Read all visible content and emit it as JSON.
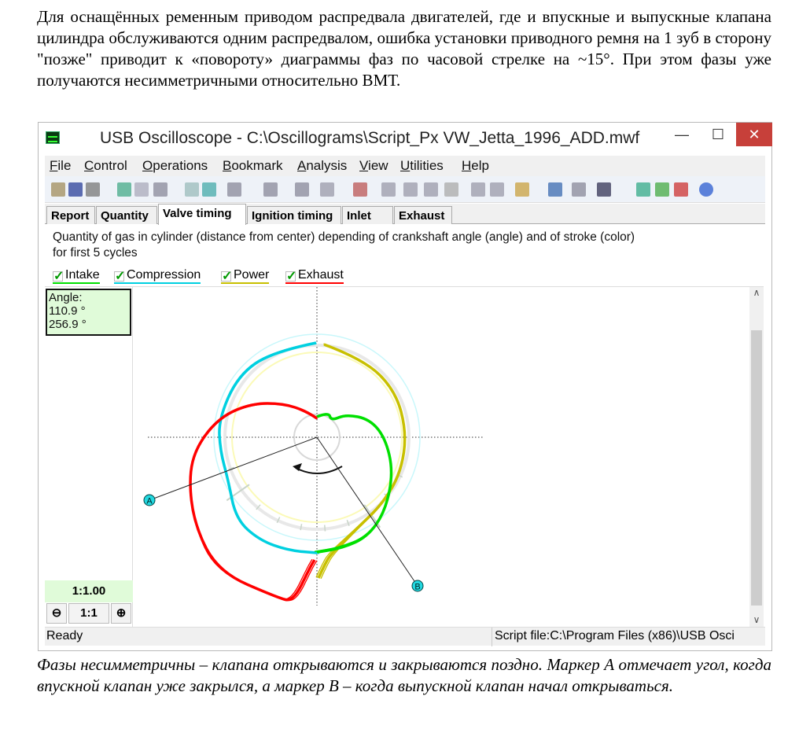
{
  "document": {
    "intro": "Для оснащённых ременным приводом распредвала двигателей, где и впускные и выпускные клапана цилиндра обслуживаются одним распредвалом, ошибка установки приводного ремня на 1 зуб в сторону \"позже\" приводит к «повороту» диаграммы фаз по часовой стрелке на ~15°. При этом фазы уже получаются несимметричными относительно ВМТ.",
    "caption": "Фазы несимметричны – клапана открываются и закрываются поздно. Маркер А отмечает угол, когда впускной клапан уже закрылся, а маркер В – когда выпускной клапан начал открываться."
  },
  "window": {
    "title": "USB Oscilloscope - C:\\Oscillograms\\Script_Px VW_Jetta_1996_ADD.mwf",
    "minimize": "—",
    "maximize": "☐",
    "close": "✕",
    "menu": [
      {
        "u": "F",
        "rest": "ile"
      },
      {
        "u": "C",
        "rest": "ontrol"
      },
      {
        "u": "O",
        "rest": "perations"
      },
      {
        "u": "B",
        "rest": "ookmark"
      },
      {
        "u": "A",
        "rest": "nalysis"
      },
      {
        "u": "V",
        "rest": "iew"
      },
      {
        "u": "U",
        "rest": "tilities"
      },
      {
        "u": "H",
        "rest": "elp"
      }
    ],
    "tabs": [
      "Report",
      "Quantity",
      "Valve timing",
      "Ignition timing",
      "Inlet",
      "Exhaust"
    ],
    "active_tab": "Valve timing",
    "description": [
      "Quantity of gas in cylinder (distance from center) depending of crankshaft angle (angle) and of stroke (color)",
      "for first 5 cycles"
    ],
    "legend": [
      {
        "label": "Intake",
        "color": "#00e000",
        "checked": true
      },
      {
        "label": "Compression",
        "color": "#00d0e0",
        "checked": true
      },
      {
        "label": "Power",
        "color": "#c8c000",
        "checked": true
      },
      {
        "label": "Exhaust",
        "color": "#ff0000",
        "checked": true
      }
    ],
    "angle_box": {
      "label": "Angle:",
      "values": [
        "110.9 °",
        "256.9 °"
      ]
    },
    "scale": "1:1.00",
    "zoom": {
      "minus": "⊖",
      "value": "1:1",
      "plus": "⊕"
    },
    "markers": [
      "A",
      "B"
    ],
    "status": {
      "left": "Ready",
      "right": "Script file:C:\\Program Files (x86)\\USB Osci"
    }
  }
}
